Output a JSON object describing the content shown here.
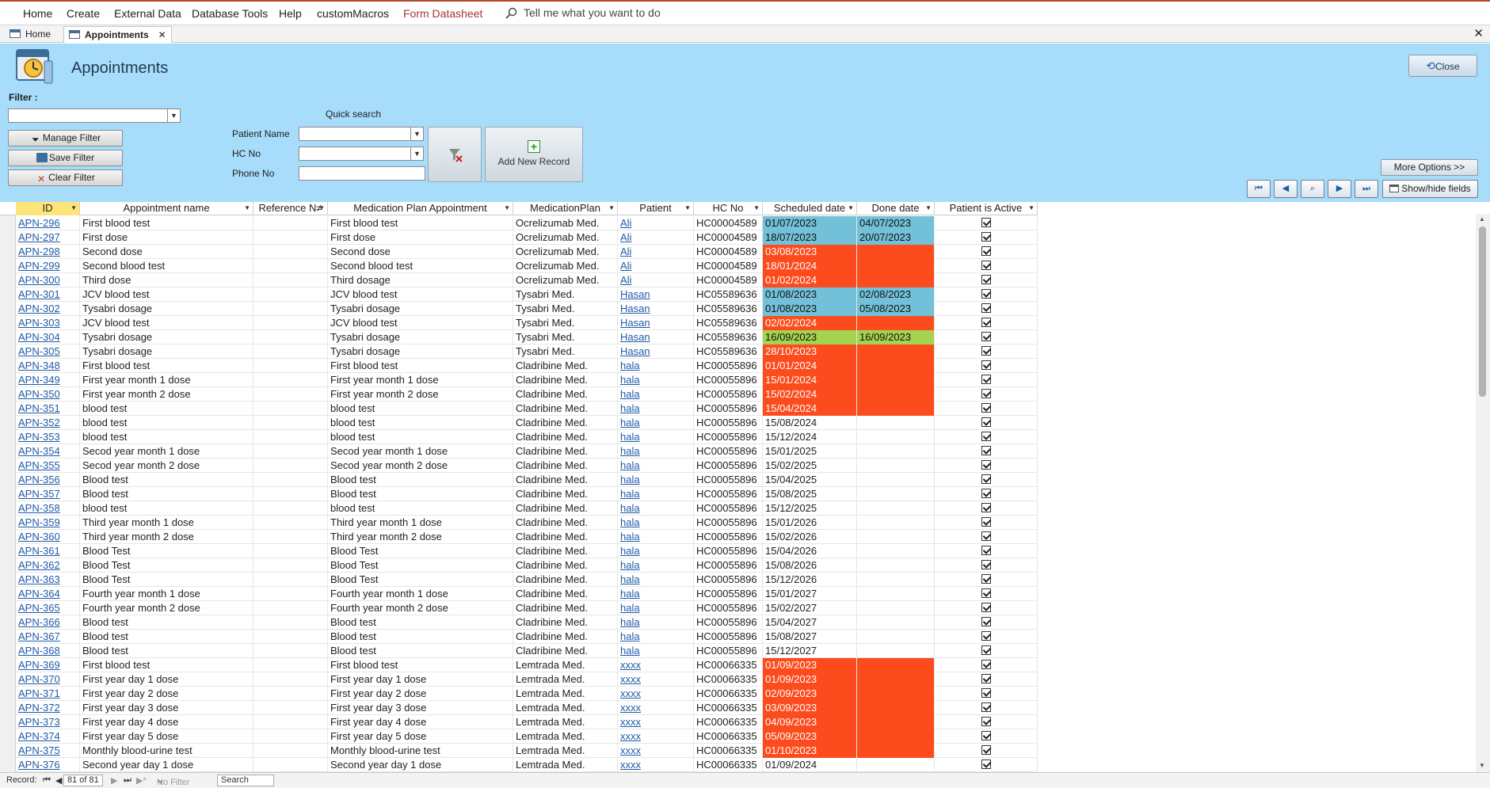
{
  "menu": [
    "Home",
    "Create",
    "External Data",
    "Database Tools",
    "Help",
    "customMacros",
    "Form Datasheet"
  ],
  "tell_me": "Tell me what you want to do",
  "tabs": [
    {
      "label": "Home",
      "active": false
    },
    {
      "label": "Appointments",
      "active": true
    }
  ],
  "form": {
    "title": "Appointments",
    "close_label": "Close",
    "filter_label": "Filter :",
    "manage_filter": "Manage Filter",
    "save_filter": "Save Filter",
    "clear_filter": "Clear Filter",
    "quick_search": "Quick search",
    "patient_name_label": "Patient Name",
    "hc_no_label": "HC No",
    "phone_no_label": "Phone No",
    "add_new_record": "Add New Record",
    "more_options": "More Options >>",
    "show_hide": "Show/hide fields"
  },
  "columns": [
    "ID",
    "Appointment name",
    "Reference N≠",
    "Medication Plan Appointment",
    "MedicationPlan",
    "Patient",
    "HC No",
    "Scheduled date",
    "Done date",
    "Patient is Active"
  ],
  "rows": [
    [
      "APN-296",
      "First blood test",
      "",
      "First blood test",
      "Ocrelizumab Med.",
      "Ali",
      "HC00004589",
      "01/07/2023",
      "04/07/2023",
      "blue"
    ],
    [
      "APN-297",
      "First dose",
      "",
      "First dose",
      "Ocrelizumab Med.",
      "Ali",
      "HC00004589",
      "18/07/2023",
      "20/07/2023",
      "blue"
    ],
    [
      "APN-298",
      "Second dose",
      "",
      "Second dose",
      "Ocrelizumab Med.",
      "Ali",
      "HC00004589",
      "03/08/2023",
      "",
      "red"
    ],
    [
      "APN-299",
      "Second blood test",
      "",
      "Second blood test",
      "Ocrelizumab Med.",
      "Ali",
      "HC00004589",
      "18/01/2024",
      "",
      "red"
    ],
    [
      "APN-300",
      "Third dose",
      "",
      "Third dosage",
      "Ocrelizumab Med.",
      "Ali",
      "HC00004589",
      "01/02/2024",
      "",
      "red"
    ],
    [
      "APN-301",
      "JCV blood test",
      "",
      "JCV blood test",
      "Tysabri Med.",
      "Hasan",
      "HC05589636",
      "01/08/2023",
      "02/08/2023",
      "blue"
    ],
    [
      "APN-302",
      "Tysabri dosage",
      "",
      "Tysabri dosage",
      "Tysabri Med.",
      "Hasan",
      "HC05589636",
      "01/08/2023",
      "05/08/2023",
      "blue"
    ],
    [
      "APN-303",
      "JCV blood test",
      "",
      "JCV blood test",
      "Tysabri Med.",
      "Hasan",
      "HC05589636",
      "02/02/2024",
      "",
      "red"
    ],
    [
      "APN-304",
      "Tysabri dosage",
      "",
      "Tysabri dosage",
      "Tysabri Med.",
      "Hasan",
      "HC05589636",
      "16/09/2023",
      "16/09/2023",
      "green"
    ],
    [
      "APN-305",
      "Tysabri dosage",
      "",
      "Tysabri dosage",
      "Tysabri Med.",
      "Hasan",
      "HC05589636",
      "28/10/2023",
      "",
      "red"
    ],
    [
      "APN-348",
      "First blood test",
      "",
      "First blood test",
      "Cladribine Med.",
      "hala",
      "HC00055896",
      "01/01/2024",
      "",
      "red"
    ],
    [
      "APN-349",
      "First year month 1 dose",
      "",
      "First year month 1 dose",
      "Cladribine Med.",
      "hala",
      "HC00055896",
      "15/01/2024",
      "",
      "red"
    ],
    [
      "APN-350",
      "First year month 2 dose",
      "",
      "First year month 2 dose",
      "Cladribine Med.",
      "hala",
      "HC00055896",
      "15/02/2024",
      "",
      "red"
    ],
    [
      "APN-351",
      "blood test",
      "",
      "blood test",
      "Cladribine Med.",
      "hala",
      "HC00055896",
      "15/04/2024",
      "",
      "red"
    ],
    [
      "APN-352",
      "blood test",
      "",
      "blood test",
      "Cladribine Med.",
      "hala",
      "HC00055896",
      "15/08/2024",
      "",
      ""
    ],
    [
      "APN-353",
      "blood test",
      "",
      "blood test",
      "Cladribine Med.",
      "hala",
      "HC00055896",
      "15/12/2024",
      "",
      ""
    ],
    [
      "APN-354",
      "Secod year month 1 dose",
      "",
      "Secod year month 1 dose",
      "Cladribine Med.",
      "hala",
      "HC00055896",
      "15/01/2025",
      "",
      ""
    ],
    [
      "APN-355",
      "Secod year month 2 dose",
      "",
      "Secod year month 2 dose",
      "Cladribine Med.",
      "hala",
      "HC00055896",
      "15/02/2025",
      "",
      ""
    ],
    [
      "APN-356",
      "Blood test",
      "",
      "Blood test",
      "Cladribine Med.",
      "hala",
      "HC00055896",
      "15/04/2025",
      "",
      ""
    ],
    [
      "APN-357",
      "Blood test",
      "",
      "Blood test",
      "Cladribine Med.",
      "hala",
      "HC00055896",
      "15/08/2025",
      "",
      ""
    ],
    [
      "APN-358",
      "blood test",
      "",
      "blood test",
      "Cladribine Med.",
      "hala",
      "HC00055896",
      "15/12/2025",
      "",
      ""
    ],
    [
      "APN-359",
      "Third year month 1 dose",
      "",
      "Third year month 1 dose",
      "Cladribine Med.",
      "hala",
      "HC00055896",
      "15/01/2026",
      "",
      ""
    ],
    [
      "APN-360",
      "Third year month 2 dose",
      "",
      "Third year month 2 dose",
      "Cladribine Med.",
      "hala",
      "HC00055896",
      "15/02/2026",
      "",
      ""
    ],
    [
      "APN-361",
      "Blood Test",
      "",
      "Blood Test",
      "Cladribine Med.",
      "hala",
      "HC00055896",
      "15/04/2026",
      "",
      ""
    ],
    [
      "APN-362",
      "Blood Test",
      "",
      "Blood Test",
      "Cladribine Med.",
      "hala",
      "HC00055896",
      "15/08/2026",
      "",
      ""
    ],
    [
      "APN-363",
      "Blood Test",
      "",
      "Blood Test",
      "Cladribine Med.",
      "hala",
      "HC00055896",
      "15/12/2026",
      "",
      ""
    ],
    [
      "APN-364",
      "Fourth year month 1 dose",
      "",
      "Fourth year month 1 dose",
      "Cladribine Med.",
      "hala",
      "HC00055896",
      "15/01/2027",
      "",
      ""
    ],
    [
      "APN-365",
      "Fourth year month 2 dose",
      "",
      "Fourth year month 2 dose",
      "Cladribine Med.",
      "hala",
      "HC00055896",
      "15/02/2027",
      "",
      ""
    ],
    [
      "APN-366",
      "Blood test",
      "",
      "Blood test",
      "Cladribine Med.",
      "hala",
      "HC00055896",
      "15/04/2027",
      "",
      ""
    ],
    [
      "APN-367",
      "Blood test",
      "",
      "Blood test",
      "Cladribine Med.",
      "hala",
      "HC00055896",
      "15/08/2027",
      "",
      ""
    ],
    [
      "APN-368",
      "Blood test",
      "",
      "Blood test",
      "Cladribine Med.",
      "hala",
      "HC00055896",
      "15/12/2027",
      "",
      ""
    ],
    [
      "APN-369",
      "First blood test",
      "",
      "First blood test",
      "Lemtrada Med.",
      "xxxx",
      "HC00066335",
      "01/09/2023",
      "",
      "red"
    ],
    [
      "APN-370",
      "First year day 1 dose",
      "",
      "First year day 1 dose",
      "Lemtrada Med.",
      "xxxx",
      "HC00066335",
      "01/09/2023",
      "",
      "red"
    ],
    [
      "APN-371",
      "First year day 2 dose",
      "",
      "First year day 2 dose",
      "Lemtrada Med.",
      "xxxx",
      "HC00066335",
      "02/09/2023",
      "",
      "red"
    ],
    [
      "APN-372",
      "First year day 3 dose",
      "",
      "First year day 3 dose",
      "Lemtrada Med.",
      "xxxx",
      "HC00066335",
      "03/09/2023",
      "",
      "red"
    ],
    [
      "APN-373",
      "First year day 4 dose",
      "",
      "First year day 4 dose",
      "Lemtrada Med.",
      "xxxx",
      "HC00066335",
      "04/09/2023",
      "",
      "red"
    ],
    [
      "APN-374",
      "First year day 5 dose",
      "",
      "First year day 5 dose",
      "Lemtrada Med.",
      "xxxx",
      "HC00066335",
      "05/09/2023",
      "",
      "red"
    ],
    [
      "APN-375",
      "Monthly blood-urine test",
      "",
      "Monthly blood-urine test",
      "Lemtrada Med.",
      "xxxx",
      "HC00066335",
      "01/10/2023",
      "",
      "red"
    ],
    [
      "APN-376",
      "Second year day 1 dose",
      "",
      "Second year day 1 dose",
      "Lemtrada Med.",
      "xxxx",
      "HC00066335",
      "01/09/2024",
      "",
      ""
    ]
  ],
  "status": {
    "record_label": "Record:",
    "record_pos": "81 of 81",
    "no_filter": "No Filter",
    "search": "Search"
  },
  "colors": {
    "overdue": "#fc4c1e",
    "done": "#73c1d8",
    "today": "#a3d34f",
    "form_bg": "#a7dcfa"
  }
}
